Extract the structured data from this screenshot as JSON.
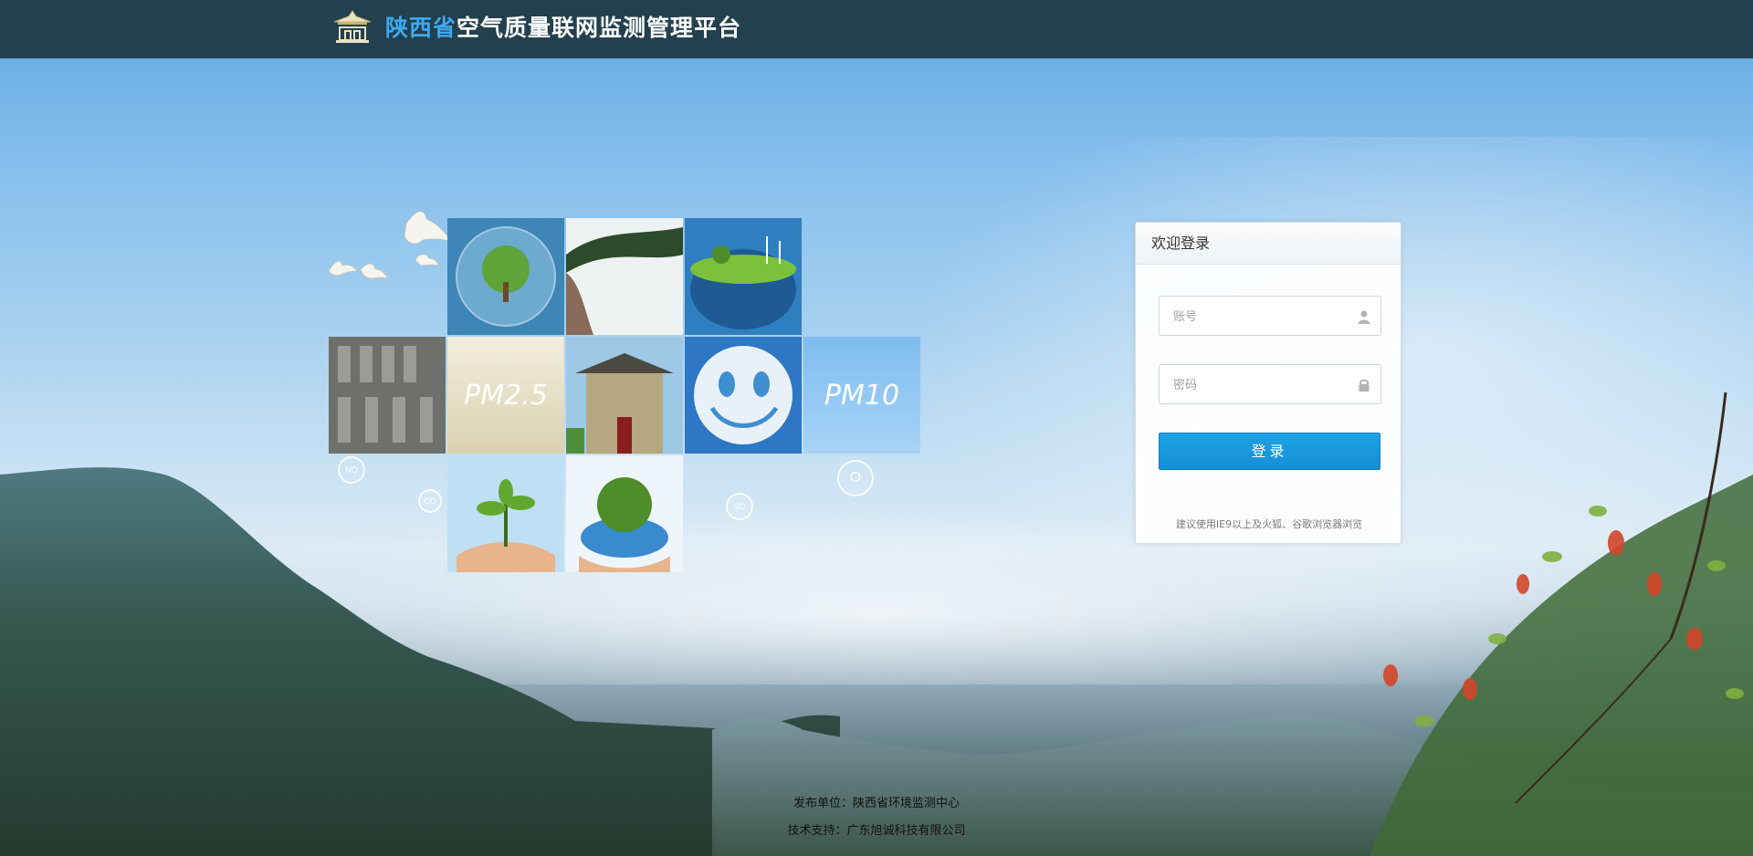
{
  "header": {
    "province": "陕西省",
    "title_rest": "空气质量联网监测管理平台",
    "logo_icon": "pagoda-gate-logo-icon"
  },
  "tiles": {
    "pm25": "PM2.5",
    "pm10": "PM10",
    "chem": [
      "NO",
      "CO",
      "SO",
      "O"
    ]
  },
  "login": {
    "title": "欢迎登录",
    "username_placeholder": "账号",
    "password_placeholder": "密码",
    "submit": "登录",
    "tip": "建议使用IE9以上及火狐、谷歌浏览器浏览"
  },
  "footer": {
    "publisher": "发布单位：陕西省环境监测中心",
    "support": "技术支持：广东旭诚科技有限公司"
  },
  "colors": {
    "header_bg": "#23404e",
    "accent_blue": "#3da8f0",
    "button": "#1a98de"
  }
}
